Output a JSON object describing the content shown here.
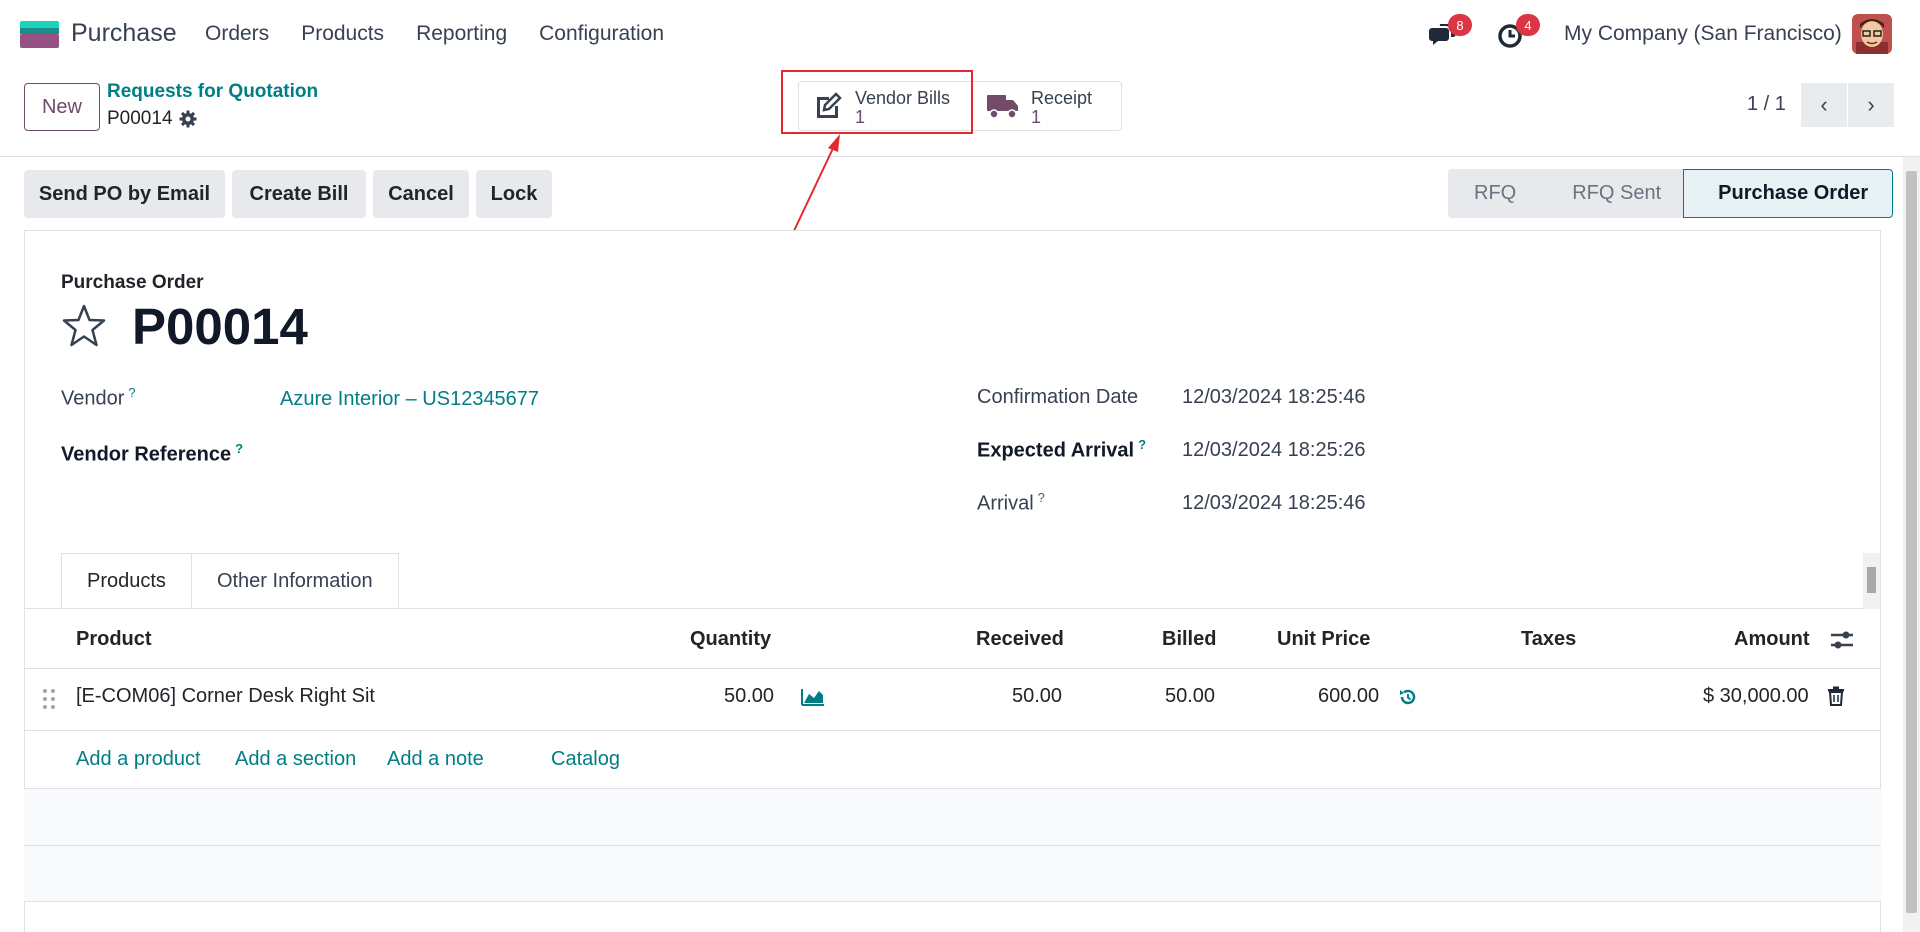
{
  "navbar": {
    "app_name": "Purchase",
    "menu": [
      "Orders",
      "Products",
      "Reporting",
      "Configuration"
    ],
    "messages_badge": "8",
    "activities_badge": "4",
    "company": "My Company (San Francisco)"
  },
  "control": {
    "new_label": "New",
    "breadcrumb_parent": "Requests for Quotation",
    "breadcrumb_current": "P00014",
    "smart_buttons": {
      "bills_label": "Vendor Bills",
      "bills_count": "1",
      "receipt_label": "Receipt",
      "receipt_count": "1"
    },
    "pager": "1 / 1"
  },
  "actions": [
    "Send PO by Email",
    "Create Bill",
    "Cancel",
    "Lock"
  ],
  "status": [
    "RFQ",
    "RFQ Sent",
    "Purchase Order"
  ],
  "record": {
    "type_label": "Purchase Order",
    "name": "P00014",
    "vendor_label": "Vendor",
    "vendor_value": "Azure Interior – US12345677",
    "vendor_ref_label": "Vendor Reference",
    "confirmation_label": "Confirmation Date",
    "confirmation_value": "12/03/2024 18:25:46",
    "expected_label": "Expected Arrival",
    "expected_value": "12/03/2024 18:25:26",
    "arrival_label": "Arrival",
    "arrival_value": "12/03/2024 18:25:46",
    "help_mark": "?"
  },
  "tabs": [
    "Products",
    "Other Information"
  ],
  "table": {
    "headers": {
      "product": "Product",
      "quantity": "Quantity",
      "received": "Received",
      "billed": "Billed",
      "unit_price": "Unit Price",
      "taxes": "Taxes",
      "amount": "Amount"
    },
    "rows": [
      {
        "product": "[E-COM06] Corner Desk Right Sit",
        "quantity": "50.00",
        "received": "50.00",
        "billed": "50.00",
        "unit_price": "600.00",
        "amount": "$ 30,000.00"
      }
    ],
    "add_links": [
      "Add a product",
      "Add a section",
      "Add a note",
      "Catalog"
    ]
  },
  "colors": {
    "brand": "#714b67",
    "link": "#017e84",
    "highlight": "#e5282e",
    "badge": "#dc3545"
  }
}
